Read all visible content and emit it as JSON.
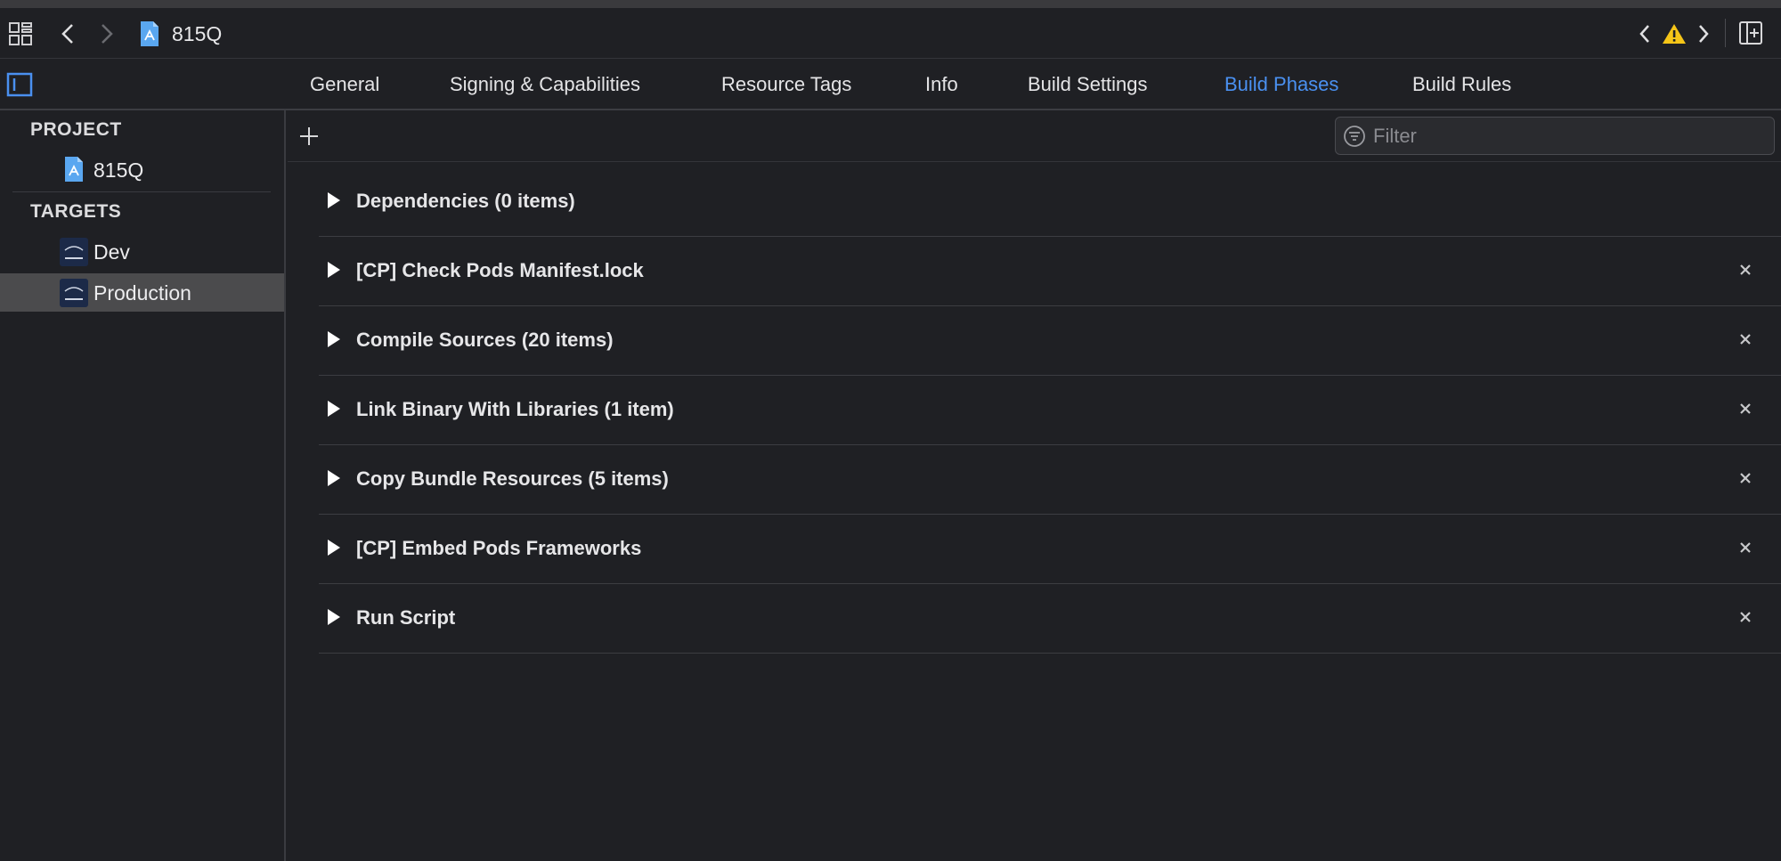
{
  "window": {
    "project_name": "815Q"
  },
  "toolbar": {
    "icons": [
      "grid-icon",
      "back-icon",
      "forward-icon",
      "project-file-icon",
      "issue-prev-icon",
      "warning-icon",
      "issue-next-icon",
      "add-editor-icon"
    ]
  },
  "tabs": [
    {
      "label": "General",
      "active": false
    },
    {
      "label": "Signing & Capabilities",
      "active": false
    },
    {
      "label": "Resource Tags",
      "active": false
    },
    {
      "label": "Info",
      "active": false
    },
    {
      "label": "Build Settings",
      "active": false
    },
    {
      "label": "Build Phases",
      "active": true
    },
    {
      "label": "Build Rules",
      "active": false
    }
  ],
  "sidebar": {
    "project_header": "PROJECT",
    "project_item": "815Q",
    "targets_header": "TARGETS",
    "targets": [
      {
        "label": "Dev",
        "selected": false
      },
      {
        "label": "Production",
        "selected": true
      }
    ]
  },
  "filter": {
    "placeholder": "Filter",
    "value": ""
  },
  "phases": [
    {
      "title": "Dependencies (0 items)",
      "removable": false
    },
    {
      "title": "[CP] Check Pods Manifest.lock",
      "removable": true
    },
    {
      "title": "Compile Sources (20 items)",
      "removable": true
    },
    {
      "title": "Link Binary With Libraries (1 item)",
      "removable": true
    },
    {
      "title": "Copy Bundle Resources (5 items)",
      "removable": true
    },
    {
      "title": "[CP] Embed Pods Frameworks",
      "removable": true
    },
    {
      "title": "Run Script",
      "removable": true
    }
  ],
  "colors": {
    "accent": "#4a90f0",
    "warning": "#f5c518",
    "background": "#1f2024",
    "selection": "#4b4b4d"
  }
}
